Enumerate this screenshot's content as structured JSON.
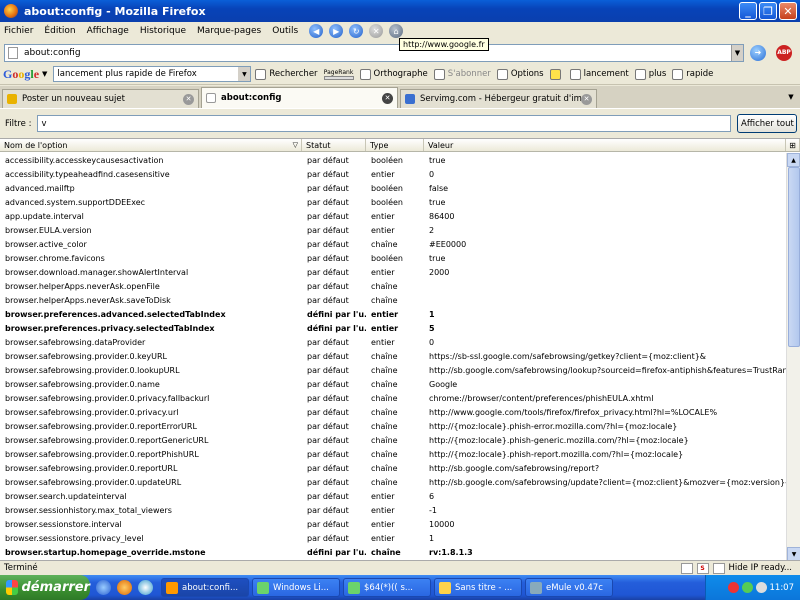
{
  "window": {
    "title": "about:config - Mozilla Firefox"
  },
  "menu": [
    "Fichier",
    "Édition",
    "Affichage",
    "Historique",
    "Marque-pages",
    "Outils"
  ],
  "tooltip": "http://www.google.fr",
  "urlbar": {
    "value": "about:config"
  },
  "google_toolbar": {
    "logo": "Google",
    "search_value": "lancement plus rapide de Firefox",
    "search_label": "Rechercher",
    "pagerank_label": "PageRank",
    "spell_label": "Orthographe",
    "subscribe_label": "S'abonner",
    "options_label": "Options",
    "terms": [
      "lancement",
      "plus",
      "rapide"
    ]
  },
  "tabs": [
    {
      "label": "Poster un nouveau sujet",
      "active": false
    },
    {
      "label": "about:config",
      "active": true
    },
    {
      "label": "Servimg.com - Hébergeur gratuit d'ima...",
      "active": false
    }
  ],
  "filter": {
    "label": "Filtre :",
    "value": "v",
    "button": "Afficher tout"
  },
  "columns": [
    "Nom de l'option",
    "Statut",
    "Type",
    "Valeur"
  ],
  "rows": [
    {
      "name": "accessibility.accesskeycausesactivation",
      "status": "par défaut",
      "type": "booléen",
      "value": "true",
      "bold": false
    },
    {
      "name": "accessibility.typeaheadfind.casesensitive",
      "status": "par défaut",
      "type": "entier",
      "value": "0",
      "bold": false
    },
    {
      "name": "advanced.mailftp",
      "status": "par défaut",
      "type": "booléen",
      "value": "false",
      "bold": false
    },
    {
      "name": "advanced.system.supportDDEExec",
      "status": "par défaut",
      "type": "booléen",
      "value": "true",
      "bold": false
    },
    {
      "name": "app.update.interval",
      "status": "par défaut",
      "type": "entier",
      "value": "86400",
      "bold": false
    },
    {
      "name": "browser.EULA.version",
      "status": "par défaut",
      "type": "entier",
      "value": "2",
      "bold": false
    },
    {
      "name": "browser.active_color",
      "status": "par défaut",
      "type": "chaîne",
      "value": "#EE0000",
      "bold": false
    },
    {
      "name": "browser.chrome.favicons",
      "status": "par défaut",
      "type": "booléen",
      "value": "true",
      "bold": false
    },
    {
      "name": "browser.download.manager.showAlertInterval",
      "status": "par défaut",
      "type": "entier",
      "value": "2000",
      "bold": false
    },
    {
      "name": "browser.helperApps.neverAsk.openFile",
      "status": "par défaut",
      "type": "chaîne",
      "value": "",
      "bold": false
    },
    {
      "name": "browser.helperApps.neverAsk.saveToDisk",
      "status": "par défaut",
      "type": "chaîne",
      "value": "",
      "bold": false
    },
    {
      "name": "browser.preferences.advanced.selectedTabIndex",
      "status": "défini par l'u...",
      "type": "entier",
      "value": "1",
      "bold": true
    },
    {
      "name": "browser.preferences.privacy.selectedTabIndex",
      "status": "défini par l'u...",
      "type": "entier",
      "value": "5",
      "bold": true
    },
    {
      "name": "browser.safebrowsing.dataProvider",
      "status": "par défaut",
      "type": "entier",
      "value": "0",
      "bold": false
    },
    {
      "name": "browser.safebrowsing.provider.0.keyURL",
      "status": "par défaut",
      "type": "chaîne",
      "value": "https://sb-ssl.google.com/safebrowsing/getkey?client={moz:client}&",
      "bold": false
    },
    {
      "name": "browser.safebrowsing.provider.0.lookupURL",
      "status": "par défaut",
      "type": "chaîne",
      "value": "http://sb.google.com/safebrowsing/lookup?sourceid=firefox-antiphish&features=TrustRan...",
      "bold": false
    },
    {
      "name": "browser.safebrowsing.provider.0.name",
      "status": "par défaut",
      "type": "chaîne",
      "value": "Google",
      "bold": false
    },
    {
      "name": "browser.safebrowsing.provider.0.privacy.fallbackurl",
      "status": "par défaut",
      "type": "chaîne",
      "value": "chrome://browser/content/preferences/phishEULA.xhtml",
      "bold": false
    },
    {
      "name": "browser.safebrowsing.provider.0.privacy.url",
      "status": "par défaut",
      "type": "chaîne",
      "value": "http://www.google.com/tools/firefox/firefox_privacy.html?hl=%LOCALE%",
      "bold": false
    },
    {
      "name": "browser.safebrowsing.provider.0.reportErrorURL",
      "status": "par défaut",
      "type": "chaîne",
      "value": "http://{moz:locale}.phish-error.mozilla.com/?hl={moz:locale}",
      "bold": false
    },
    {
      "name": "browser.safebrowsing.provider.0.reportGenericURL",
      "status": "par défaut",
      "type": "chaîne",
      "value": "http://{moz:locale}.phish-generic.mozilla.com/?hl={moz:locale}",
      "bold": false
    },
    {
      "name": "browser.safebrowsing.provider.0.reportPhishURL",
      "status": "par défaut",
      "type": "chaîne",
      "value": "http://{moz:locale}.phish-report.mozilla.com/?hl={moz:locale}",
      "bold": false
    },
    {
      "name": "browser.safebrowsing.provider.0.reportURL",
      "status": "par défaut",
      "type": "chaîne",
      "value": "http://sb.google.com/safebrowsing/report?",
      "bold": false
    },
    {
      "name": "browser.safebrowsing.provider.0.updateURL",
      "status": "par défaut",
      "type": "chaîne",
      "value": "http://sb.google.com/safebrowsing/update?client={moz:client}&mozver={moz:version}-{...",
      "bold": false
    },
    {
      "name": "browser.search.updateinterval",
      "status": "par défaut",
      "type": "entier",
      "value": "6",
      "bold": false
    },
    {
      "name": "browser.sessionhistory.max_total_viewers",
      "status": "par défaut",
      "type": "entier",
      "value": "-1",
      "bold": false
    },
    {
      "name": "browser.sessionstore.interval",
      "status": "par défaut",
      "type": "entier",
      "value": "10000",
      "bold": false
    },
    {
      "name": "browser.sessionstore.privacy_level",
      "status": "par défaut",
      "type": "entier",
      "value": "1",
      "bold": false
    },
    {
      "name": "browser.startup.homepage_override.mstone",
      "status": "défini par l'u...",
      "type": "chaîne",
      "value": "rv:1.8.1.3",
      "bold": true
    }
  ],
  "status": {
    "text": "Terminé",
    "right": "Hide IP ready..."
  },
  "taskbar": {
    "start": "démarrer",
    "tasks": [
      {
        "label": "about:confi...",
        "active": true
      },
      {
        "label": "Windows Li...",
        "active": false
      },
      {
        "label": "$64(*)((  s...",
        "active": false
      },
      {
        "label": "Sans titre - ...",
        "active": false
      },
      {
        "label": "eMule v0.47c",
        "active": false
      }
    ],
    "clock": "11:07"
  }
}
